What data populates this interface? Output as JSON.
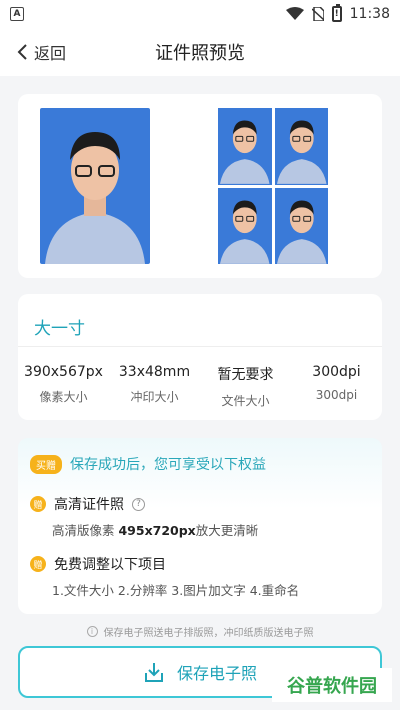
{
  "status_bar": {
    "time": "11:38"
  },
  "nav": {
    "back_label": "返回",
    "title": "证件照预览"
  },
  "size": {
    "name": "大一寸",
    "specs": [
      {
        "value": "390x567px",
        "label": "像素大小"
      },
      {
        "value": "33x48mm",
        "label": "冲印大小"
      },
      {
        "value": "暂无要求",
        "label": "文件大小"
      },
      {
        "value": "300dpi",
        "label": "300dpi"
      }
    ]
  },
  "benefits": {
    "badge": "买赠",
    "title": "保存成功后，您可享受以下权益",
    "item1_title": "高清证件照",
    "item1_desc_prefix": "高清版像素 ",
    "item1_desc_bold": "495x720px",
    "item1_desc_suffix": "放大更清晰",
    "item2_title": "免费调整以下项目",
    "item2_desc": "1.文件大小  2.分辨率  3.图片加文字  4.重命名"
  },
  "note": "保存电子照送电子排版照，冲印纸质版送电子照",
  "save_button": "保存电子照",
  "watermark": "谷普软件园",
  "colors": {
    "accent": "#1fa3b8",
    "photo_bg": "#3a7ad8",
    "gold": "#f6b21b"
  }
}
